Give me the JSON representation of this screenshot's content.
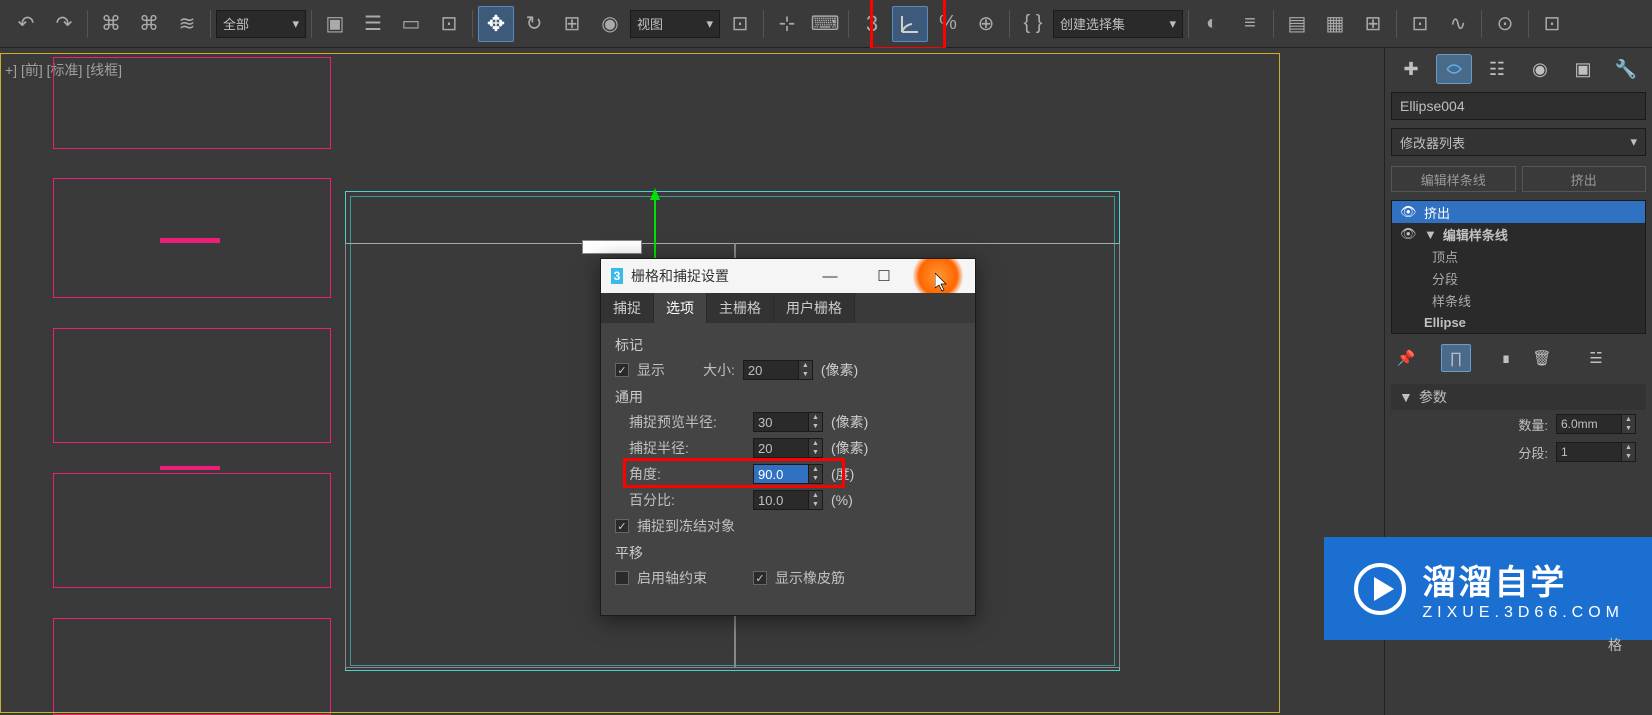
{
  "toolbar": {
    "filter_all": "全部",
    "view_dropdown": "视图",
    "selection_set": "创建选择集",
    "snap_3": "3",
    "percent": "%"
  },
  "viewport": {
    "label": "+] [前] [标准] [线框]"
  },
  "dialog": {
    "title": "栅格和捕捉设置",
    "title_icon": "3",
    "tabs": {
      "snap": "捕捉",
      "options": "选项",
      "main_grid": "主栅格",
      "user_grid": "用户栅格"
    },
    "marker": {
      "group": "标记",
      "show": "显示",
      "size_label": "大小:",
      "size_value": "20",
      "size_unit": "(像素)"
    },
    "general": {
      "group": "通用",
      "preview_radius": "捕捉预览半径:",
      "preview_value": "30",
      "snap_radius": "捕捉半径:",
      "snap_value": "20",
      "angle": "角度:",
      "angle_value": "90.0",
      "angle_unit": "(度)",
      "percent": "百分比:",
      "percent_value": "10.0",
      "percent_unit": "(%)",
      "pixel_unit": "(像素)",
      "snap_frozen": "捕捉到冻结对象"
    },
    "translate": {
      "group": "平移",
      "axis_constraint": "启用轴约束",
      "rubber_band": "显示橡皮筋"
    }
  },
  "right_panel": {
    "object_name": "Ellipse004",
    "modifier_list": "修改器列表",
    "mod_buttons": {
      "edit_spline": "编辑样条线",
      "extrude": "挤出"
    },
    "stack": {
      "extrude": "挤出",
      "edit_spline": "编辑样条线",
      "vertex": "顶点",
      "segment": "分段",
      "spline": "样条线",
      "ellipse": "Ellipse"
    },
    "rollout": {
      "params": "参数",
      "amount": "数量:",
      "amount_value": "6.0mm",
      "segments": "分段:",
      "segments_value": "1",
      "mesh": "网格",
      "grid_label": "格"
    }
  },
  "watermark": {
    "main": "溜溜自学",
    "sub": "ZIXUE.3D66.COM"
  }
}
